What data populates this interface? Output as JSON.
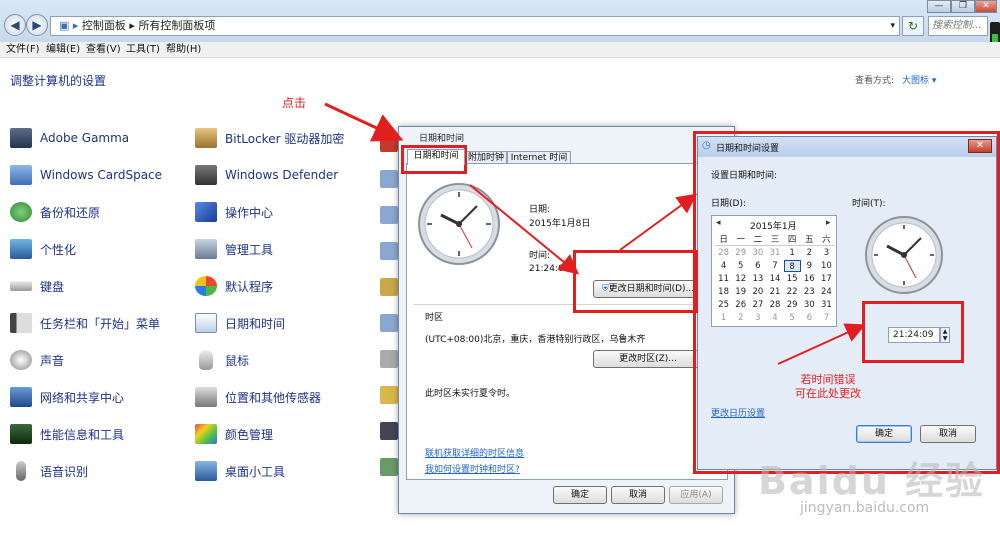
{
  "window": {
    "address_path": [
      "控制面板",
      "所有控制面板项"
    ],
    "search_placeholder": "搜索控制...",
    "refresh_glyph": "↻",
    "controls": [
      "—",
      "❐",
      "✕"
    ]
  },
  "menu": [
    "文件(F)",
    "编辑(E)",
    "查看(V)",
    "工具(T)",
    "帮助(H)"
  ],
  "content": {
    "title": "调整计算机的设置",
    "view_by_label": "查看方式:",
    "view_by_value": "大图标 ▾",
    "col1": [
      "Adobe Gamma",
      "Windows CardSpace",
      "备份和还原",
      "个性化",
      "键盘",
      "任务栏和「开始」菜单",
      "声音",
      "网络和共享中心",
      "性能信息和工具",
      "语音识别"
    ],
    "col2": [
      "BitLocker 驱动器加密",
      "Windows Defender",
      "操作中心",
      "管理工具",
      "默认程序",
      "日期和时间",
      "鼠标",
      "位置和其他传感器",
      "颜色管理",
      "桌面小工具"
    ]
  },
  "annotation": {
    "click_hint": "点击",
    "error_note_line1": "若时间错误",
    "error_note_line2": "可在此处更改"
  },
  "dialog1": {
    "title": "日期和时间",
    "tabs": [
      "日期和时间",
      "附加时钟",
      "Internet 时间"
    ],
    "date_label": "日期:",
    "date_value": "2015年1月8日",
    "time_label": "时间:",
    "time_value": "21:24:09",
    "change_datetime_button": "更改日期和时间(D)...",
    "timezone_label": "时区",
    "timezone_value": "(UTC+08:00)北京，重庆，香港特别行政区，乌鲁木齐",
    "change_timezone_button": "更改时区(Z)...",
    "dst_note": "此时区未实行夏令时。",
    "link1": "联机获取详细的时区信息",
    "link2": "我如何设置时钟和时区?",
    "ok": "确定",
    "cancel": "取消",
    "apply": "应用(A)"
  },
  "dialog2": {
    "title": "日期和时间设置",
    "close": "✕",
    "instruction": "设置日期和时间:",
    "date_label": "日期(D):",
    "time_label": "时间(T):",
    "month": "2015年1月",
    "prev": "◂",
    "next": "▸",
    "weekdays": [
      "日",
      "一",
      "二",
      "三",
      "四",
      "五",
      "六"
    ],
    "days": [
      "28",
      "29",
      "30",
      "31",
      "1",
      "2",
      "3",
      "4",
      "5",
      "6",
      "7",
      "8",
      "9",
      "10",
      "11",
      "12",
      "13",
      "14",
      "15",
      "16",
      "17",
      "18",
      "19",
      "20",
      "21",
      "22",
      "23",
      "24",
      "25",
      "26",
      "27",
      "28",
      "29",
      "30",
      "31",
      "1",
      "2",
      "3",
      "4",
      "5",
      "6",
      "7"
    ],
    "time_value": "21:24:09",
    "change_calendar_link": "更改日历设置",
    "ok": "确定",
    "cancel": "取消"
  },
  "watermark": {
    "brand": "Baidu 经验",
    "url": "jingyan.baidu.com"
  }
}
